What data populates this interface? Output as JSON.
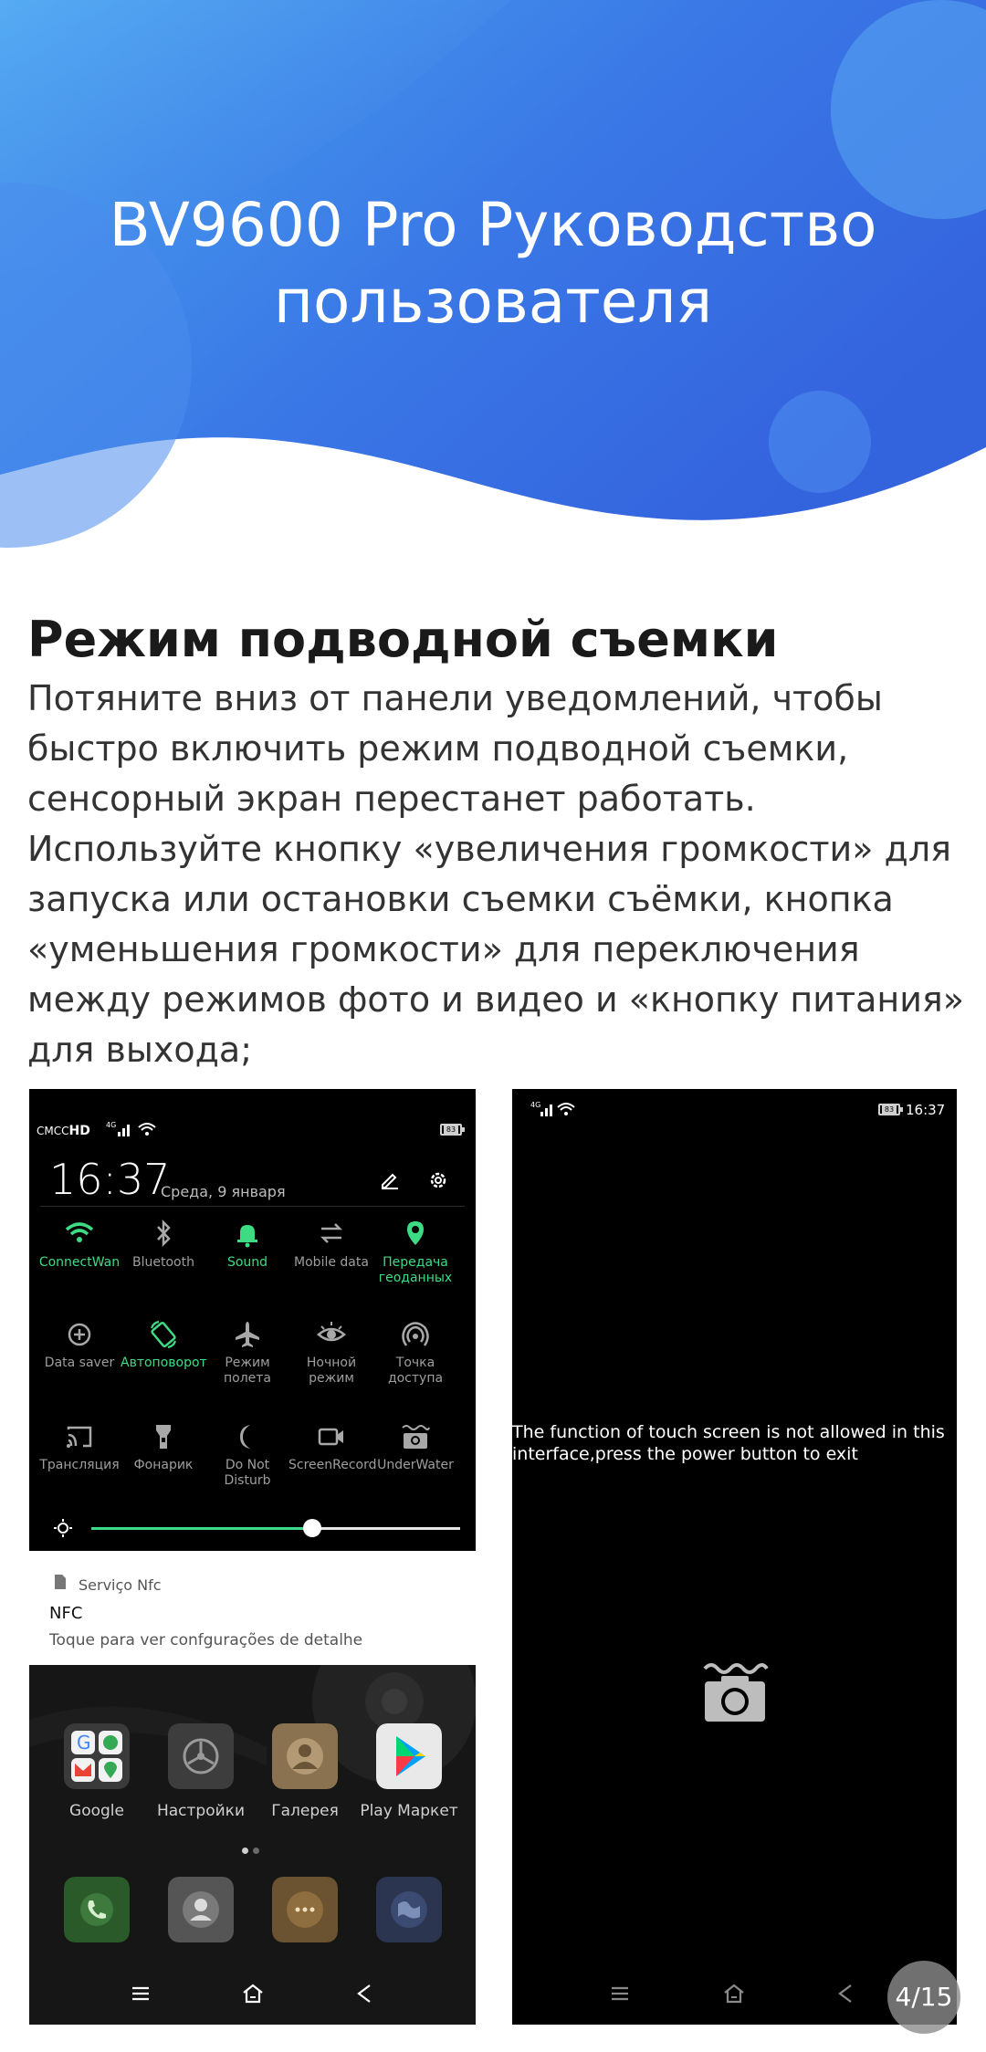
{
  "hero": {
    "title_line1": "BV9600 Pro Руководство",
    "title_line2": "пользователя"
  },
  "article": {
    "heading": "Режим подводной съемки",
    "body": "Потяните вниз от панели уведомлений, чтобы быстро включить режим подводной съемки, сенсорный экран перестанет работать. Используйте кнопку «увеличения громкости» для запуска или остановки съемки съёмки, кнопка «уменьшения громкости» для переключения между режимов фото и видео и «кнопку питания» для выхода;"
  },
  "left_shot": {
    "status_bar": {
      "carrier": "CMCC",
      "hd": "HD",
      "network": "4G",
      "battery": "83"
    },
    "quick_settings": {
      "time": "16:37",
      "date": "Среда, 9 января",
      "edit_icon": "pencil-icon",
      "settings_icon": "gear-icon",
      "tiles": [
        {
          "label": "ConnectWan",
          "icon": "wifi-icon",
          "on": true
        },
        {
          "label": "Bluetooth",
          "icon": "bluetooth-icon",
          "on": false
        },
        {
          "label": "Sound",
          "icon": "bell-icon",
          "on": true
        },
        {
          "label": "Mobile data",
          "icon": "data-arrows-icon",
          "on": false
        },
        {
          "label": "Передача геоданных",
          "icon": "location-icon",
          "on": true
        },
        {
          "label": "Data saver",
          "icon": "data-saver-icon",
          "on": false
        },
        {
          "label": "Автоповорот",
          "icon": "auto-rotate-icon",
          "on": true
        },
        {
          "label": "Режим полета",
          "icon": "airplane-icon",
          "on": false
        },
        {
          "label": "Ночной режим",
          "icon": "eye-icon",
          "on": false
        },
        {
          "label": "Точка доступа",
          "icon": "hotspot-icon",
          "on": false
        },
        {
          "label": "Трансляция",
          "icon": "cast-icon",
          "on": false
        },
        {
          "label": "Фонарик",
          "icon": "flashlight-icon",
          "on": false
        },
        {
          "label": "Do Not Disturb",
          "icon": "moon-icon",
          "on": false
        },
        {
          "label": "ScreenRecord",
          "icon": "video-camera-icon",
          "on": false
        },
        {
          "label": "UnderWater",
          "icon": "underwater-camera-icon",
          "on": false
        }
      ],
      "brightness": 0.6
    },
    "notification": {
      "app": "Serviço Nfc",
      "title": "NFC",
      "subtitle": "Toque para ver confgurações de detalhe"
    },
    "home": {
      "apps": [
        {
          "label": "Google",
          "icon": "google-folder-icon"
        },
        {
          "label": "Настройки",
          "icon": "settings-app-icon"
        },
        {
          "label": "Галерея",
          "icon": "gallery-app-icon"
        },
        {
          "label": "Play Маркет",
          "icon": "play-store-icon"
        }
      ],
      "dock": [
        "phone-icon",
        "contacts-icon",
        "messages-icon",
        "browser-icon"
      ],
      "page_dots": 2,
      "active_page": 0
    }
  },
  "right_shot": {
    "network": "4G",
    "battery": "83",
    "time": "16:37",
    "message": "The function of touch screen is not allowed in this interface,press the power button to exit",
    "center_icon": "underwater-camera-icon"
  },
  "page_counter": "4/15",
  "colors": {
    "accent_green": "#3ddc84",
    "hero_blue": "#3f7fe8"
  }
}
